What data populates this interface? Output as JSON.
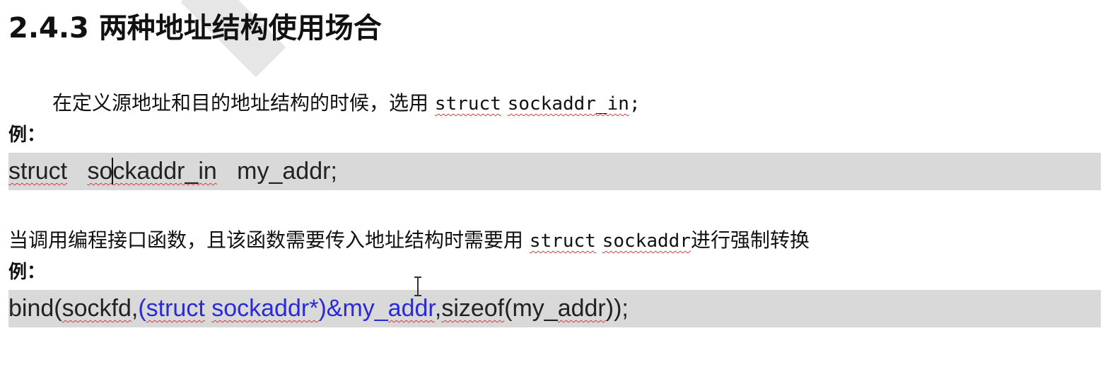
{
  "heading": "2.4.3 两种地址结构使用场合",
  "section1": {
    "text": "在定义源地址和目的地址结构的时候，选用",
    "code_a": "struct",
    "code_b": "sockaddr_in",
    "code_end": ";",
    "example_label": "例：",
    "code_line": {
      "word1": "struct",
      "word2_pre": "so",
      "word2_post": "ckaddr_in",
      "word3": "my_addr;"
    }
  },
  "section2": {
    "text": "当调用编程接口函数，且该函数需要传入地址结构时需要用",
    "code_a": "struct",
    "code_b": "sockaddr",
    "text_after": "进行强制转换",
    "example_label": "例：",
    "code_line": {
      "bind": "bind(",
      "sockfd": "sockfd",
      "comma1": ",",
      "cast_open": "(",
      "cast_struct": "struct",
      "cast_sockaddr": "sockaddr*",
      "cast_close": ")&my_",
      "addr": "addr",
      "comma2": ",",
      "sizeof": "sizeof",
      "sizeof_open": "(my_",
      "addr2": "addr",
      "tail": "));"
    }
  },
  "colors": {
    "code_bg": "#d9d9d9",
    "cast_blue": "#2a2ad6",
    "spell_red": "#d23b3b"
  }
}
